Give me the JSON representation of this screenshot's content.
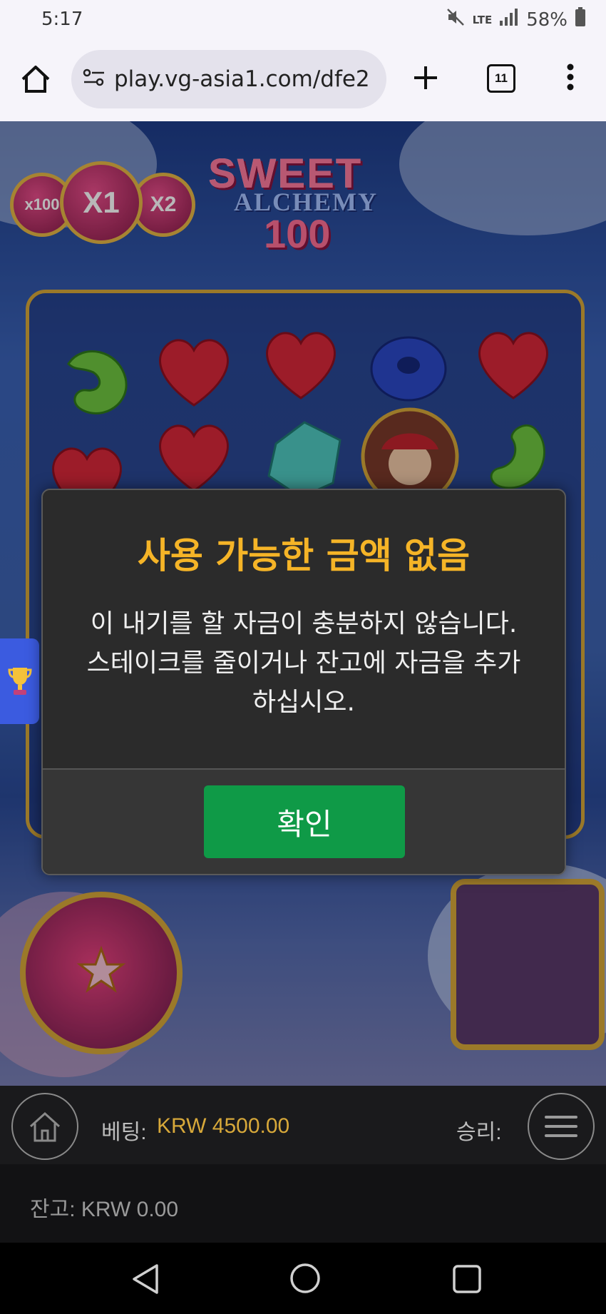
{
  "status_bar": {
    "time": "5:17",
    "network": "LTE",
    "battery": "58%",
    "icons": [
      "mute-icon",
      "signal-icon",
      "battery-icon"
    ]
  },
  "browser": {
    "url": "play.vg-asia1.com/dfe2",
    "tab_count": "11",
    "icons": [
      "home-icon",
      "site-settings-icon",
      "new-tab-icon",
      "tab-switcher-icon",
      "more-menu-icon"
    ]
  },
  "game": {
    "logo": {
      "line1": "SWEET",
      "line2": "ALCHEMY",
      "line3": "100"
    },
    "multipliers": [
      "x100",
      "X1",
      "X2"
    ]
  },
  "dialog": {
    "title": "사용 가능한 금액 없음",
    "message_line1": "이 내기를 할 자금이 충분하지 않습니다.",
    "message_line2": "스테이크를 줄이거나 잔고에 자금을 추가",
    "message_line3": "하십시오.",
    "confirm_label": "확인"
  },
  "bet_bar": {
    "bet_label": "베팅:",
    "bet_value": "KRW 4500.00",
    "win_label": "승리:"
  },
  "balance_bar": {
    "balance_text": "잔고: KRW 0.00"
  },
  "colors": {
    "dialog_title": "#f5b427",
    "confirm_button": "#0f9a47",
    "bet_value": "#d7a83a"
  }
}
